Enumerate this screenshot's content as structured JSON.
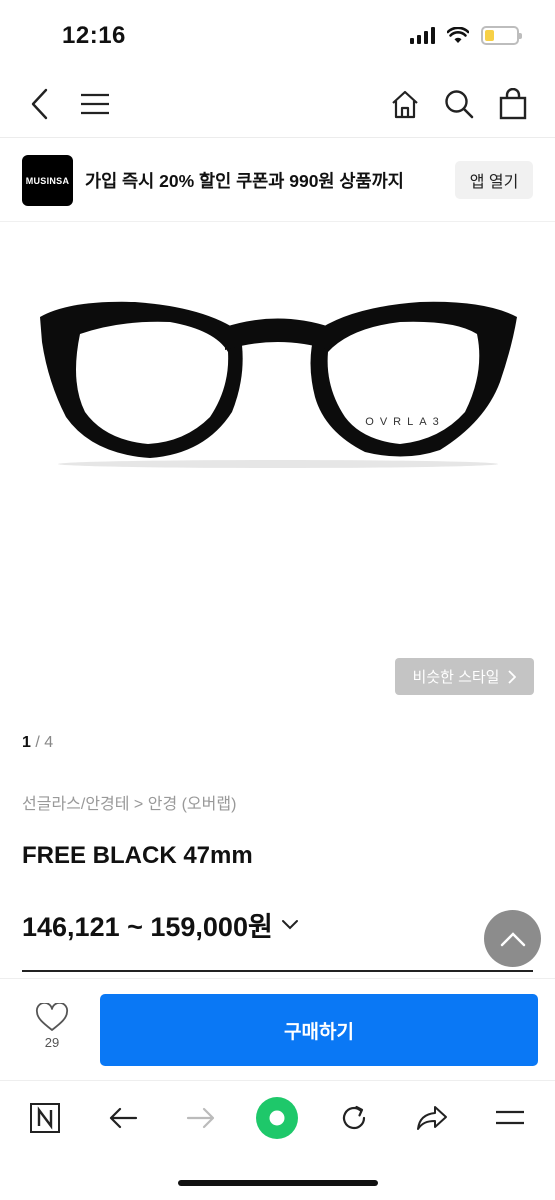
{
  "status": {
    "time": "12:16",
    "battery_level": 0.3
  },
  "nav": {
    "back_icon": "chevron-left-icon",
    "menu_icon": "hamburger-icon",
    "home_icon": "home-icon",
    "search_icon": "search-icon",
    "cart_icon": "shopping-bag-icon"
  },
  "banner": {
    "logo_text": "MUSINSA",
    "message": "가입 즉시 20% 할인 쿠폰과 990원 상품까지",
    "open_app_label": "앱 열기"
  },
  "product": {
    "brand_on_lens": "OVRLA3",
    "similar_style_label": "비슷한 스타일",
    "pager_current": "1",
    "pager_total": " / 4",
    "breadcrumb": "선글라스/안경테 > 안경 (오버랩)",
    "title": "FREE BLACK 47mm",
    "price": "146,121 ~ 159,000원"
  },
  "actions": {
    "like_count": "29",
    "buy_label": "구매하기"
  },
  "colors": {
    "accent": "#0a78f5",
    "browser_green": "#1ec86a"
  }
}
